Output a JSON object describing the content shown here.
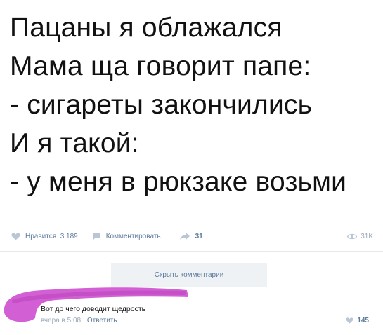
{
  "post": {
    "lines": [
      "Пацаны я облажался",
      "Мама ща говорит папе:",
      "- сигареты закончились",
      "И я такой:",
      "- у меня в рюкзаке возьми"
    ]
  },
  "actions": {
    "like_label": "Нравится",
    "like_count": "3 189",
    "comment_label": "Комментировать",
    "share_count": "31",
    "views_count": "31K"
  },
  "comments": {
    "hide_label": "Скрыть комментарии",
    "items": [
      {
        "text": "Вот до чего доводит щедрость",
        "time": "вчера в 5:08",
        "reply_label": "Ответить",
        "likes": "145"
      }
    ]
  },
  "colors": {
    "link": "#5b7a9c",
    "muted": "#9aa8b8",
    "button_bg": "#eff2f5",
    "scribble": "#d35fd4"
  },
  "icons": [
    "heart-icon",
    "comment-icon",
    "share-icon",
    "eye-icon"
  ]
}
